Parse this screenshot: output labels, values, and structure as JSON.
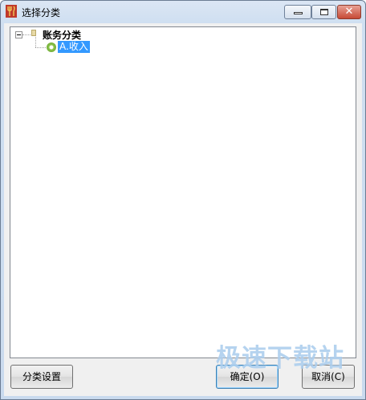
{
  "window": {
    "title": "选择分类",
    "icon": "app-fork-icon"
  },
  "caption": {
    "minimize_icon": "minimize-icon",
    "maximize_icon": "maximize-icon",
    "close_glyph": "✕"
  },
  "tree": {
    "root": {
      "label": "账务分类",
      "expanded": true
    },
    "children": [
      {
        "label": "A.收入",
        "selected": true
      }
    ]
  },
  "buttons": {
    "category_settings": "分类设置",
    "ok": "确定(O)",
    "cancel": "取消(C)"
  },
  "watermark": "极速下载站",
  "colors": {
    "selection": "#3399ff",
    "close_button": "#c74a36"
  }
}
